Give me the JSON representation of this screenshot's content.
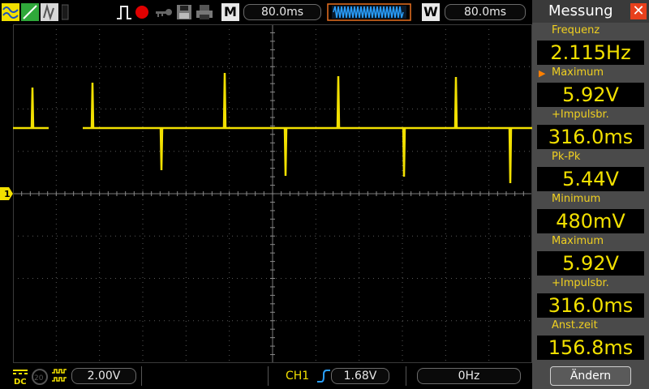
{
  "top": {
    "memory_label": "M",
    "memory_time": "80.0ms",
    "window_label": "W",
    "window_time": "80.0ms"
  },
  "bottom": {
    "ch_scale": "2.00V",
    "trigger_channel": "CH1",
    "trigger_level": "1.68V",
    "frequency": "0Hz"
  },
  "panel": {
    "title": "Messung",
    "change_button": "Ändern",
    "measurements": [
      {
        "label": "Frequenz",
        "value": "2.115Hz"
      },
      {
        "label": "Maximum",
        "value": "5.92V"
      },
      {
        "label": "+Impulsbr.",
        "value": "316.0ms"
      },
      {
        "label": "Pk-Pk",
        "value": "5.44V"
      },
      {
        "label": "Minimum",
        "value": "480mV"
      },
      {
        "label": "Maximum",
        "value": "5.92V"
      },
      {
        "label": "+Impulsbr.",
        "value": "316.0ms"
      },
      {
        "label": "Anst.zeit",
        "value": "156.8ms"
      }
    ]
  },
  "channel_marker": "1",
  "colors": {
    "trace": "#f2e000",
    "label": "#f0d020",
    "panel_bg": "#4a4a4a",
    "close": "#e8401c",
    "selected_arrow": "#ff8000"
  }
}
